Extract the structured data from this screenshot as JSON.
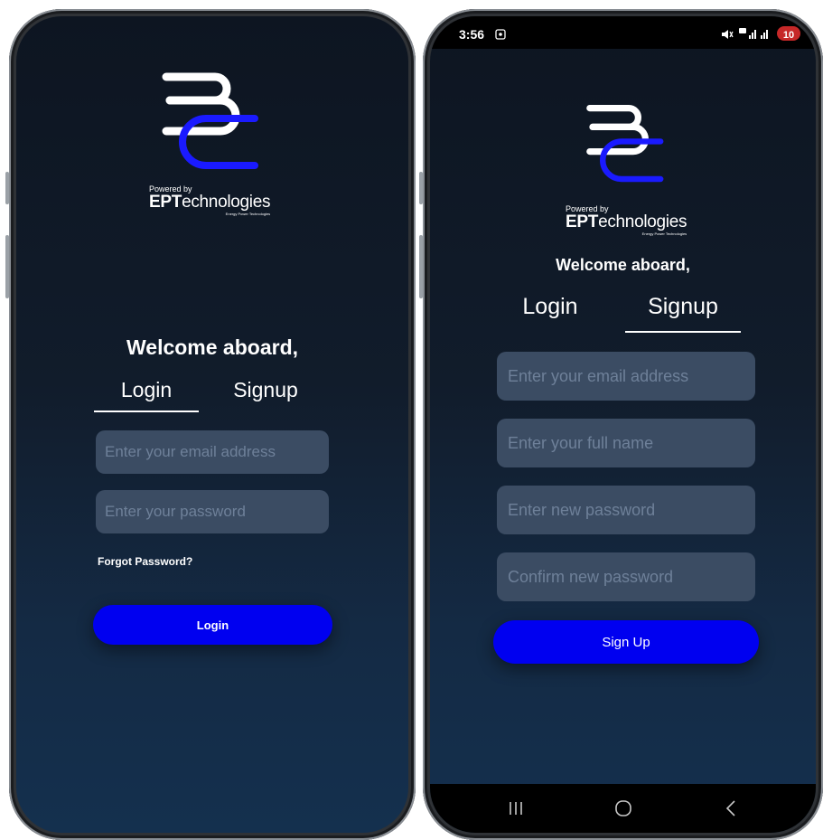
{
  "left_phone": {
    "welcome": "Welcome aboard,",
    "tabs": {
      "login": "Login",
      "signup": "Signup",
      "active": "login"
    },
    "powered_by": {
      "small": "Powered by",
      "brand_bold": "EPT",
      "brand_rest": "echnologies",
      "tagline": "Energy Power Technologies"
    },
    "email_placeholder": "Enter your email address",
    "password_placeholder": "Enter your password",
    "forgot": "Forgot Password?",
    "login_button": "Login"
  },
  "right_phone": {
    "status": {
      "time": "3:56",
      "battery": "10"
    },
    "welcome": "Welcome aboard,",
    "tabs": {
      "login": "Login",
      "signup": "Signup",
      "active": "signup"
    },
    "powered_by": {
      "small": "Powered by",
      "brand_bold": "EPT",
      "brand_rest": "echnologies",
      "tagline": "Energy Power Technologies"
    },
    "email_placeholder": "Enter your email address",
    "fullname_placeholder": "Enter your full name",
    "newpass_placeholder": "Enter new password",
    "confirmpass_placeholder": "Confirm new password",
    "signup_button": "Sign Up"
  },
  "colors": {
    "accent_blue": "#0000f0",
    "logo_blue": "#1a1aff",
    "field_bg": "#3b4c63"
  },
  "icons": [
    "logo-icon",
    "screenshot-icon",
    "mute-icon",
    "signal-icon",
    "battery-icon",
    "recents-icon",
    "home-icon",
    "back-icon"
  ]
}
